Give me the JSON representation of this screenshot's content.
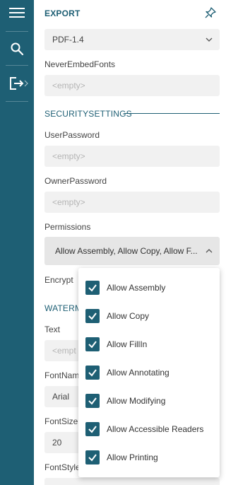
{
  "header": {
    "title": "EXPORT"
  },
  "pdf_version": {
    "value": "PDF-1.4"
  },
  "never_embed_fonts": {
    "label": "NeverEmbedFonts",
    "placeholder": "<empty>"
  },
  "security": {
    "section_title": "SECURITYSETTINGS",
    "user_password": {
      "label": "UserPassword",
      "placeholder": "<empty>"
    },
    "owner_password": {
      "label": "OwnerPassword",
      "placeholder": "<empty>"
    },
    "permissions": {
      "label": "Permissions",
      "value": "Allow Assembly, Allow Copy, Allow F..."
    },
    "encrypt": {
      "label": "Encrypt"
    }
  },
  "watermark": {
    "section_title": "WATERM",
    "text": {
      "label": "Text",
      "placeholder": "<empt"
    },
    "font_name": {
      "label": "FontNam",
      "value": "Arial"
    },
    "font_size": {
      "label": "FontSize",
      "value": "20"
    },
    "font_style": {
      "label": "FontStyle"
    }
  },
  "permission_options": [
    {
      "label": "Allow Assembly",
      "checked": true
    },
    {
      "label": "Allow Copy",
      "checked": true
    },
    {
      "label": "Allow FillIn",
      "checked": true
    },
    {
      "label": "Allow Annotating",
      "checked": true
    },
    {
      "label": "Allow Modifying",
      "checked": true
    },
    {
      "label": "Allow Accessible Readers",
      "checked": true
    },
    {
      "label": "Allow Printing",
      "checked": true
    }
  ],
  "colors": {
    "accent": "#1e5f74",
    "field_bg": "#f1f1f1",
    "placeholder": "#b5b5b5"
  },
  "icons": [
    "menu-icon",
    "search-icon",
    "export-icon",
    "chevron-right-icon",
    "pin-icon",
    "chevron-down-icon",
    "chevron-up-icon",
    "checkmark-icon"
  ]
}
